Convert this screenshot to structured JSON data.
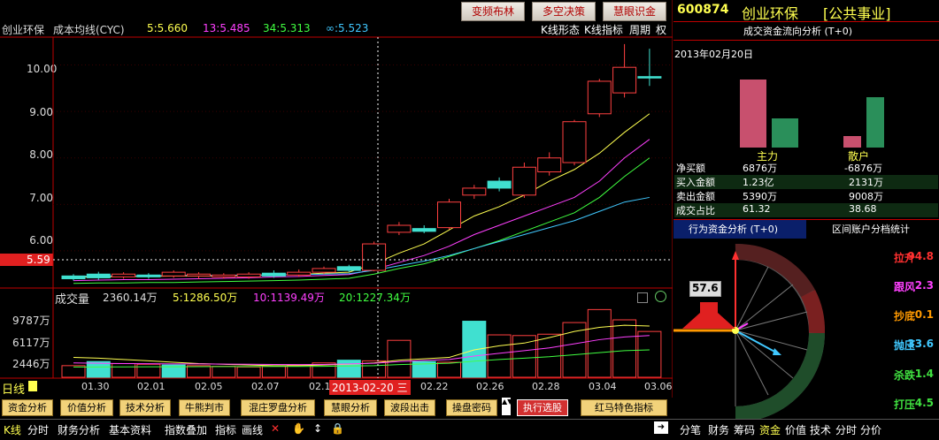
{
  "topbar": {
    "buttons": [
      "变频布林",
      "多空决策",
      "慧眼识金"
    ]
  },
  "stock": {
    "code": "600874",
    "name": "创业环保",
    "sector": "[公共事业]"
  },
  "chart_header": {
    "name": "创业环保",
    "indicator": "成本均线(CYC)",
    "ma5": "5:5.660",
    "ma13": "13:5.485",
    "ma34": "34:5.313",
    "ma_inf": "∞:5.523",
    "right_items": [
      "K线形态",
      "K线指标",
      "周期",
      "权"
    ]
  },
  "price_axis": {
    "labels": [
      "10.00",
      "9.00",
      "8.00",
      "7.00",
      "6.00"
    ],
    "current": "5.59"
  },
  "volume_header": {
    "title": "成交量",
    "vol": "2360.14万",
    "v5": "5:1286.50万",
    "v10": "10:1139.49万",
    "v20": "20:1227.34万"
  },
  "volume_axis": [
    "9787万",
    "6117万",
    "2446万"
  ],
  "x_axis": {
    "period": "日线",
    "ticks": [
      "01.30",
      "02.01",
      "02.05",
      "02.07",
      "02.1",
      "02.22",
      "02.26",
      "02.28",
      "03.04",
      "03.06"
    ],
    "cursor": "2013-02-20 三"
  },
  "toolbar": [
    "资金分析",
    "价值分析",
    "技术分析",
    "牛熊判市",
    "混庄罗盘分析",
    "慧眼分析",
    "波段出击",
    "操盘密码",
    "执行选股",
    "红马特色指标"
  ],
  "bottombar": [
    "K线",
    "分时",
    "财务分析",
    "基本资料",
    "指数叠加",
    "指标",
    "画线"
  ],
  "bottom_right": [
    "分笔",
    "财务",
    "筹码",
    "资金",
    "价值",
    "技术",
    "分时",
    "分价"
  ],
  "right_panel": {
    "title": "成交资金流向分析 (T+0)",
    "date": "2013年02月20日",
    "cat_main": "主力",
    "cat_retail": "散户",
    "rows": [
      {
        "label": "净买额",
        "main": "6876万",
        "retail": "-6876万"
      },
      {
        "label": "买入金额",
        "main": "1.23亿",
        "retail": "2131万"
      },
      {
        "label": "卖出金额",
        "main": "5390万",
        "retail": "9008万"
      },
      {
        "label": "成交占比",
        "main": "61.32",
        "retail": "38.68"
      }
    ],
    "tab_active": "行为资金分析 (T+0)",
    "tab_other": "区间账户分档统计",
    "dial_value": "57.6",
    "dial_items": [
      {
        "label": "拉升",
        "value": "94.8",
        "color": "#ff3030"
      },
      {
        "label": "跟风",
        "value": "2.3",
        "color": "#ff40ff"
      },
      {
        "label": "抄底",
        "value": "0.1",
        "color": "#ff9900"
      },
      {
        "label": "抛压",
        "value": "33.6",
        "color": "#40c8ff"
      },
      {
        "label": "杀跌",
        "value": "1.4",
        "color": "#40e040"
      },
      {
        "label": "打压",
        "value": "4.5",
        "color": "#40e040"
      }
    ]
  },
  "chart_data": {
    "type": "candlestick",
    "ylim": [
      5.2,
      10.6
    ],
    "candles": [
      {
        "o": 5.46,
        "c": 5.4,
        "h": 5.5,
        "l": 5.36
      },
      {
        "o": 5.5,
        "c": 5.42,
        "h": 5.55,
        "l": 5.38
      },
      {
        "o": 5.44,
        "c": 5.5,
        "h": 5.54,
        "l": 5.4
      },
      {
        "o": 5.48,
        "c": 5.44,
        "h": 5.52,
        "l": 5.4
      },
      {
        "o": 5.46,
        "c": 5.54,
        "h": 5.58,
        "l": 5.42
      },
      {
        "o": 5.46,
        "c": 5.5,
        "h": 5.54,
        "l": 5.4
      },
      {
        "o": 5.44,
        "c": 5.48,
        "h": 5.52,
        "l": 5.4
      },
      {
        "o": 5.44,
        "c": 5.5,
        "h": 5.54,
        "l": 5.4
      },
      {
        "o": 5.52,
        "c": 5.46,
        "h": 5.58,
        "l": 5.42
      },
      {
        "o": 5.48,
        "c": 5.54,
        "h": 5.6,
        "l": 5.44
      },
      {
        "o": 5.54,
        "c": 5.62,
        "h": 5.66,
        "l": 5.5
      },
      {
        "o": 5.66,
        "c": 5.58,
        "h": 5.7,
        "l": 5.54
      },
      {
        "o": 5.58,
        "c": 6.15,
        "h": 6.2,
        "l": 5.56
      },
      {
        "o": 6.4,
        "c": 6.55,
        "h": 6.62,
        "l": 6.34
      },
      {
        "o": 6.48,
        "c": 6.42,
        "h": 6.55,
        "l": 6.38
      },
      {
        "o": 6.5,
        "c": 7.05,
        "h": 7.12,
        "l": 6.46
      },
      {
        "o": 7.2,
        "c": 7.35,
        "h": 7.42,
        "l": 7.12
      },
      {
        "o": 7.5,
        "c": 7.35,
        "h": 7.58,
        "l": 7.28
      },
      {
        "o": 7.2,
        "c": 7.8,
        "h": 7.9,
        "l": 7.14
      },
      {
        "o": 7.7,
        "c": 8.0,
        "h": 8.12,
        "l": 7.62
      },
      {
        "o": 7.9,
        "c": 8.78,
        "h": 8.82,
        "l": 7.84
      },
      {
        "o": 8.95,
        "c": 9.65,
        "h": 9.7,
        "l": 8.88
      },
      {
        "o": 9.4,
        "c": 9.95,
        "h": 10.45,
        "l": 9.3
      },
      {
        "o": 9.75,
        "c": 9.72,
        "h": 10.35,
        "l": 9.55
      }
    ],
    "ma5": [
      5.43,
      5.44,
      5.45,
      5.45,
      5.46,
      5.46,
      5.46,
      5.47,
      5.48,
      5.49,
      5.52,
      5.54,
      5.72,
      5.95,
      6.15,
      6.45,
      6.75,
      6.95,
      7.2,
      7.5,
      7.75,
      8.1,
      8.55,
      8.95
    ],
    "ma13": [
      5.36,
      5.37,
      5.38,
      5.38,
      5.39,
      5.4,
      5.41,
      5.42,
      5.44,
      5.45,
      5.47,
      5.49,
      5.6,
      5.75,
      5.9,
      6.1,
      6.35,
      6.55,
      6.75,
      6.95,
      7.15,
      7.5,
      8.0,
      8.4
    ],
    "ma34": [
      5.3,
      5.31,
      5.31,
      5.32,
      5.32,
      5.33,
      5.34,
      5.35,
      5.36,
      5.37,
      5.39,
      5.41,
      5.5,
      5.62,
      5.72,
      5.88,
      6.05,
      6.22,
      6.42,
      6.62,
      6.82,
      7.15,
      7.6,
      8.0
    ],
    "ma_inf": [
      5.45,
      5.46,
      5.46,
      5.46,
      5.47,
      5.47,
      5.47,
      5.48,
      5.48,
      5.49,
      5.5,
      5.51,
      5.58,
      5.68,
      5.78,
      5.9,
      6.05,
      6.2,
      6.35,
      6.5,
      6.65,
      6.85,
      7.05,
      7.15
    ],
    "volume_ylim": [
      0,
      11500
    ],
    "volume": [
      {
        "v": 1700,
        "up": false
      },
      {
        "v": 2300,
        "up": true
      },
      {
        "v": 2000,
        "up": false
      },
      {
        "v": 1900,
        "up": false
      },
      {
        "v": 1800,
        "up": true
      },
      {
        "v": 1700,
        "up": false
      },
      {
        "v": 1600,
        "up": false
      },
      {
        "v": 1500,
        "up": false
      },
      {
        "v": 1600,
        "up": false
      },
      {
        "v": 1800,
        "up": false
      },
      {
        "v": 2100,
        "up": false
      },
      {
        "v": 2500,
        "up": true
      },
      {
        "v": 2400,
        "up": false
      },
      {
        "v": 5400,
        "up": false
      },
      {
        "v": 2300,
        "up": true
      },
      {
        "v": 2200,
        "up": false
      },
      {
        "v": 8200,
        "up": true
      },
      {
        "v": 6200,
        "up": false
      },
      {
        "v": 6100,
        "up": false
      },
      {
        "v": 6300,
        "up": false
      },
      {
        "v": 8000,
        "up": false
      },
      {
        "v": 9900,
        "up": false
      },
      {
        "v": 8400,
        "up": false
      },
      {
        "v": 6700,
        "up": false
      }
    ],
    "vol_ma5": [
      2900,
      2800,
      2600,
      2400,
      2200,
      2000,
      1900,
      1800,
      1700,
      1700,
      1800,
      1900,
      2100,
      2500,
      2700,
      2900,
      4000,
      4600,
      5000,
      5800,
      6700,
      7300,
      7600,
      7500
    ],
    "vol_ma10": [
      2100,
      2050,
      2000,
      1980,
      1960,
      1950,
      1930,
      1900,
      1880,
      1850,
      1880,
      1950,
      2050,
      2300,
      2450,
      2600,
      3100,
      3500,
      3900,
      4300,
      4900,
      5500,
      5900,
      6100
    ],
    "vol_ma20": [
      1500,
      1500,
      1520,
      1530,
      1540,
      1550,
      1560,
      1570,
      1580,
      1590,
      1600,
      1650,
      1700,
      1850,
      1950,
      2050,
      2350,
      2600,
      2800,
      3000,
      3300,
      3600,
      3900,
      4000
    ]
  }
}
